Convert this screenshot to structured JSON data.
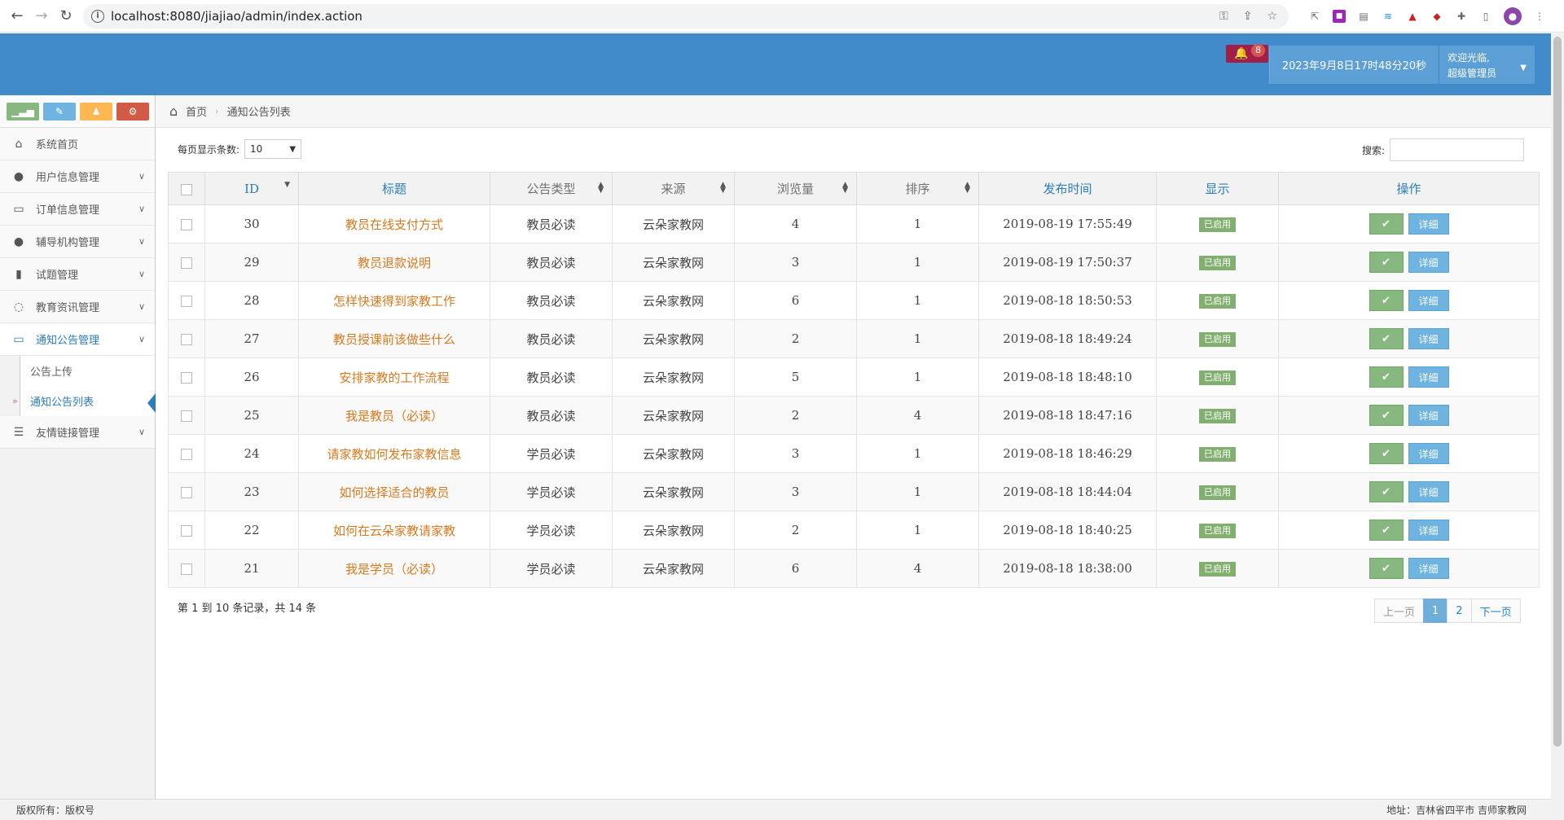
{
  "browser": {
    "url": "localhost:8080/jiajiao/admin/index.action"
  },
  "header": {
    "notification_count": "8",
    "datetime": "2023年9月8日17时48分20秒",
    "welcome": "欢迎光临,",
    "role": "超级管理员"
  },
  "sidebar": {
    "items": [
      {
        "label": "系统首页",
        "icon": "home-icon"
      },
      {
        "label": "用户信息管理",
        "icon": "user-icon"
      },
      {
        "label": "订单信息管理",
        "icon": "credit-card-icon"
      },
      {
        "label": "辅导机构管理",
        "icon": "user-icon"
      },
      {
        "label": "试题管理",
        "icon": "bookmark-icon"
      },
      {
        "label": "教育资讯管理",
        "icon": "comments-icon"
      },
      {
        "label": "通知公告管理",
        "icon": "desktop-icon"
      },
      {
        "label": "友情链接管理",
        "icon": "list-icon"
      }
    ],
    "sub_items": [
      {
        "label": "公告上传"
      },
      {
        "label": "通知公告列表"
      }
    ]
  },
  "breadcrumb": {
    "home": "首页",
    "current": "通知公告列表"
  },
  "controls": {
    "page_size_label": "每页显示条数:",
    "page_size_value": "10",
    "search_label": "搜索:"
  },
  "table": {
    "headers": [
      "ID",
      "标题",
      "公告类型",
      "来源",
      "浏览量",
      "排序",
      "发布时间",
      "显示",
      "操作"
    ],
    "rows": [
      {
        "id": "30",
        "title": "教员在线支付方式",
        "type": "教员必读",
        "source": "云朵家教网",
        "views": "4",
        "order": "1",
        "time": "2019-08-19 17:55:49",
        "status": "已启用"
      },
      {
        "id": "29",
        "title": "教员退款说明",
        "type": "教员必读",
        "source": "云朵家教网",
        "views": "3",
        "order": "1",
        "time": "2019-08-19 17:50:37",
        "status": "已启用"
      },
      {
        "id": "28",
        "title": "怎样快速得到家教工作",
        "type": "教员必读",
        "source": "云朵家教网",
        "views": "6",
        "order": "1",
        "time": "2019-08-18 18:50:53",
        "status": "已启用"
      },
      {
        "id": "27",
        "title": "教员授课前该做些什么",
        "type": "教员必读",
        "source": "云朵家教网",
        "views": "2",
        "order": "1",
        "time": "2019-08-18 18:49:24",
        "status": "已启用"
      },
      {
        "id": "26",
        "title": "安排家教的工作流程",
        "type": "教员必读",
        "source": "云朵家教网",
        "views": "5",
        "order": "1",
        "time": "2019-08-18 18:48:10",
        "status": "已启用"
      },
      {
        "id": "25",
        "title": "我是教员（必读）",
        "type": "教员必读",
        "source": "云朵家教网",
        "views": "2",
        "order": "4",
        "time": "2019-08-18 18:47:16",
        "status": "已启用"
      },
      {
        "id": "24",
        "title": "请家教如何发布家教信息",
        "type": "学员必读",
        "source": "云朵家教网",
        "views": "3",
        "order": "1",
        "time": "2019-08-18 18:46:29",
        "status": "已启用"
      },
      {
        "id": "23",
        "title": "如何选择适合的教员",
        "type": "学员必读",
        "source": "云朵家教网",
        "views": "3",
        "order": "1",
        "time": "2019-08-18 18:44:04",
        "status": "已启用"
      },
      {
        "id": "22",
        "title": "如何在云朵家教请家教",
        "type": "学员必读",
        "source": "云朵家教网",
        "views": "2",
        "order": "1",
        "time": "2019-08-18 18:40:25",
        "status": "已启用"
      },
      {
        "id": "21",
        "title": "我是学员（必读）",
        "type": "学员必读",
        "source": "云朵家教网",
        "views": "6",
        "order": "4",
        "time": "2019-08-18 18:38:00",
        "status": "已启用"
      }
    ],
    "detail_label": "详细"
  },
  "pagination": {
    "info": "第 1 到 10 条记录，共 14 条",
    "prev": "上一页",
    "pages": [
      "1",
      "2"
    ],
    "next": "下一页"
  },
  "footer": {
    "left": "版权所有：版权号",
    "right": "地址：吉林省四平市 吉师家教网"
  },
  "colors": {
    "header_bg": "#428bca",
    "title_link": "#d77a1f",
    "badge_green": "#82af6f"
  }
}
